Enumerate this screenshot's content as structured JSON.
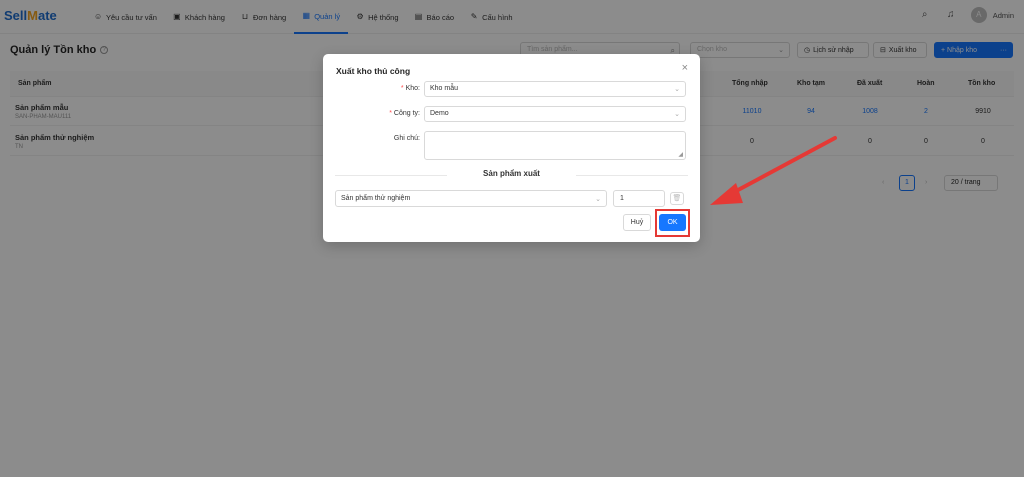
{
  "app": {
    "logo_part1": "Sell",
    "logo_part2": "M",
    "logo_part3": "ate"
  },
  "nav": {
    "items": [
      {
        "label": "Yêu cầu tư vấn",
        "icon": "chat-icon"
      },
      {
        "label": "Khách hàng",
        "icon": "contacts-icon"
      },
      {
        "label": "Đơn hàng",
        "icon": "cart-icon"
      },
      {
        "label": "Quản lý",
        "icon": "grid-icon",
        "active": true
      },
      {
        "label": "Hệ thống",
        "icon": "gear-icon"
      },
      {
        "label": "Báo cáo",
        "icon": "chart-icon"
      },
      {
        "label": "Cấu hình",
        "icon": "wrench-icon"
      }
    ],
    "user": "Admin",
    "avatar_letter": "A"
  },
  "page": {
    "title": "Quản lý Tồn kho",
    "search_placeholder": "Tìm sản phẩm...",
    "warehouse_placeholder": "Chọn kho",
    "btn_history": "Lịch sử nhập",
    "btn_export": "Xuất kho",
    "btn_import": "+ Nhập kho",
    "btn_more": "···"
  },
  "table": {
    "columns": [
      "Sản phẩm",
      "Tổng nhập",
      "Kho tạm",
      "Đã xuất",
      "Hoàn",
      "Tồn kho"
    ],
    "rows": [
      {
        "name": "Sản phẩm mẫu",
        "sku": "SAN-PHAM-MAU111",
        "total_in": "11010",
        "temp": "94",
        "exported": "1008",
        "returned": "2",
        "stock": "9910"
      },
      {
        "name": "Sản phẩm thử nghiệm",
        "sku": "TN",
        "total_in": "0",
        "temp": "",
        "exported": "0",
        "returned": "0",
        "stock": "0"
      }
    ]
  },
  "pagination": {
    "current": "1",
    "page_size": "20 / trang"
  },
  "modal": {
    "title": "Xuất kho thủ công",
    "warehouse_label": "Kho",
    "warehouse_value": "Kho mẫu",
    "company_label": "Công ty",
    "company_value": "Demo",
    "note_label": "Ghi chú",
    "note_value": "",
    "section_title": "Sản phẩm xuất",
    "product_value": "Sản phẩm thử nghiệm",
    "quantity": "1",
    "cancel_label": "Huỷ",
    "ok_label": "OK"
  },
  "colors": {
    "primary": "#1677ff",
    "highlight": "#e53935"
  }
}
